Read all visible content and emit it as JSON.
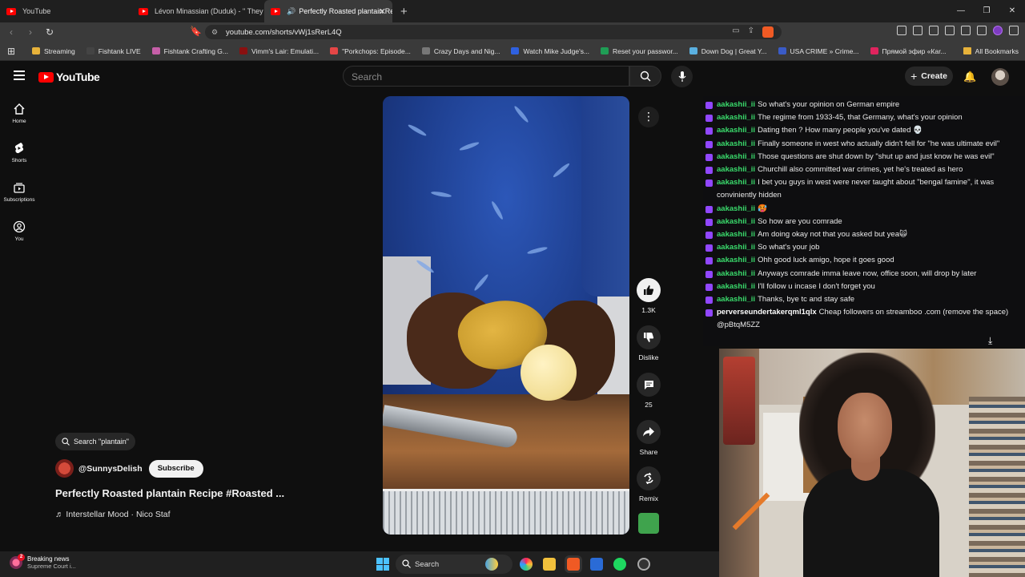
{
  "browser": {
    "tabs": [
      {
        "title": "YouTube",
        "active": false
      },
      {
        "title": "Lévon Minassian (Duduk) - \" They Ha",
        "active": false
      },
      {
        "title": "Perfectly Roasted plantain Re",
        "active": true
      }
    ],
    "url": "youtube.com/shorts/vWj1sRerL4Q",
    "bookmarks": [
      {
        "label": "Streaming",
        "color": "#e7b23a"
      },
      {
        "label": "Fishtank LIVE",
        "color": "#444444"
      },
      {
        "label": "Fishtank Crafting G...",
        "color": "#c65fa8"
      },
      {
        "label": "Vimm's Lair: Emulati...",
        "color": "#8a1010"
      },
      {
        "label": "\"Porkchops: Episode...",
        "color": "#e54646"
      },
      {
        "label": "Crazy Days and Nig...",
        "color": "#777777"
      },
      {
        "label": "Watch Mike Judge's...",
        "color": "#2f61e0"
      },
      {
        "label": "Reset your passwor...",
        "color": "#1f9d55"
      },
      {
        "label": "Down Dog | Great Y...",
        "color": "#5ab0e0"
      },
      {
        "label": "USA CRIME » Crime...",
        "color": "#3a5bc7"
      },
      {
        "label": "Прямой эфир «Кar...",
        "color": "#e0245e"
      }
    ],
    "all_bookmarks": "All Bookmarks"
  },
  "youtube": {
    "logo": "YouTube",
    "search_placeholder": "Search",
    "create_label": "Create",
    "nav": [
      {
        "label": "Home",
        "icon": "home-icon"
      },
      {
        "label": "Shorts",
        "icon": "shorts-icon"
      },
      {
        "label": "Subscriptions",
        "icon": "subscriptions-icon"
      },
      {
        "label": "You",
        "icon": "you-icon"
      }
    ],
    "short": {
      "search_chip": "Search \"plantain\"",
      "channel": "@SunnysDelish",
      "subscribe": "Subscribe",
      "title": "Perfectly Roasted plantain Recipe #Roasted ...",
      "music": "Interstellar Mood · Nico Staf"
    },
    "actions": {
      "likes": "1.3K",
      "dislike": "Dislike",
      "comments": "25",
      "share": "Share",
      "remix": "Remix"
    }
  },
  "chat": {
    "messages": [
      {
        "user": "aakashii_ii",
        "text": "So what's your opinion on German empire"
      },
      {
        "user": "aakashii_ii",
        "text": "The regime from 1933-45, that Germany, what's your opinion"
      },
      {
        "user": "aakashii_ii",
        "text": "Dating then ? How many people you've dated 💀"
      },
      {
        "user": "aakashii_ii",
        "text": "Finally someone in west who actually didn't fell for \"he was ultimate evil\""
      },
      {
        "user": "aakashii_ii",
        "text": "Those questions are shut down by \"shut up and just know he was evil\""
      },
      {
        "user": "aakashii_ii",
        "text": "Churchill also committed war crimes, yet he's treated as hero"
      },
      {
        "user": "aakashii_ii",
        "text": "I bet you guys in west were never taught about \"bengal famine\", it was conviniently hidden"
      },
      {
        "user": "aakashii_ii",
        "text": "🥵"
      },
      {
        "user": "aakashii_ii",
        "text": "So how are you comrade"
      },
      {
        "user": "aakashii_ii",
        "text": "Am doing okay not that you asked but yea🙀"
      },
      {
        "user": "aakashii_ii",
        "text": "So what's your job"
      },
      {
        "user": "aakashii_ii",
        "text": "Ohh good luck amigo, hope it goes good"
      },
      {
        "user": "aakashii_ii",
        "text": "Anyways comrade imma leave now, office soon, will drop by later"
      },
      {
        "user": "aakashii_ii",
        "text": "I'll follow u incase I don't forget you"
      },
      {
        "user": "aakashii_ii",
        "text": "Thanks, bye tc and stay safe"
      },
      {
        "user": "perverseundertakerqml1qlx",
        "text": "Cheap followers on streamboo .com (remove the space) @pBtqM5ZZ"
      }
    ]
  },
  "taskbar": {
    "news_title": "Breaking news",
    "news_sub": "Supreme Court i...",
    "news_badge": "2",
    "search": "Search"
  }
}
